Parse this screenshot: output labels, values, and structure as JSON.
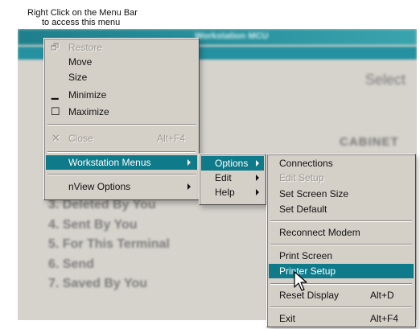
{
  "caption": {
    "line1": "Right Click on the Menu Bar",
    "line2": "to access this menu"
  },
  "background": {
    "title_fragment": "Workstation MCU",
    "select_text": "Select",
    "cabinet_text": "CABINET",
    "list": [
      "3. Deleted By You",
      "4. Sent By You",
      "5. For This Terminal",
      "6. Send",
      "7. Saved By You"
    ]
  },
  "system_menu": {
    "restore": "Restore",
    "move": "Move",
    "size": "Size",
    "minimize": "Minimize",
    "maximize": "Maximize",
    "close": "Close",
    "close_shortcut": "Alt+F4",
    "workstation_menus": "Workstation Menus",
    "nview_options": "nView Options"
  },
  "submenu": {
    "options": "Options",
    "edit": "Edit",
    "help": "Help"
  },
  "options_menu": {
    "connections": "Connections",
    "edit_setup": "Edit Setup",
    "set_screen_size": "Set Screen Size",
    "set_default": "Set Default",
    "reconnect_modem": "Reconnect Modem",
    "print_screen": "Print Screen",
    "printer_setup": "Printer Setup",
    "reset_display": "Reset Display",
    "reset_display_shortcut": "Alt+D",
    "exit": "Exit",
    "exit_shortcut": "Alt+F4"
  },
  "colors": {
    "highlight": "#0f7a8a",
    "menu_bg": "#d4d0c8",
    "titlebar": "#1f7f8c"
  }
}
